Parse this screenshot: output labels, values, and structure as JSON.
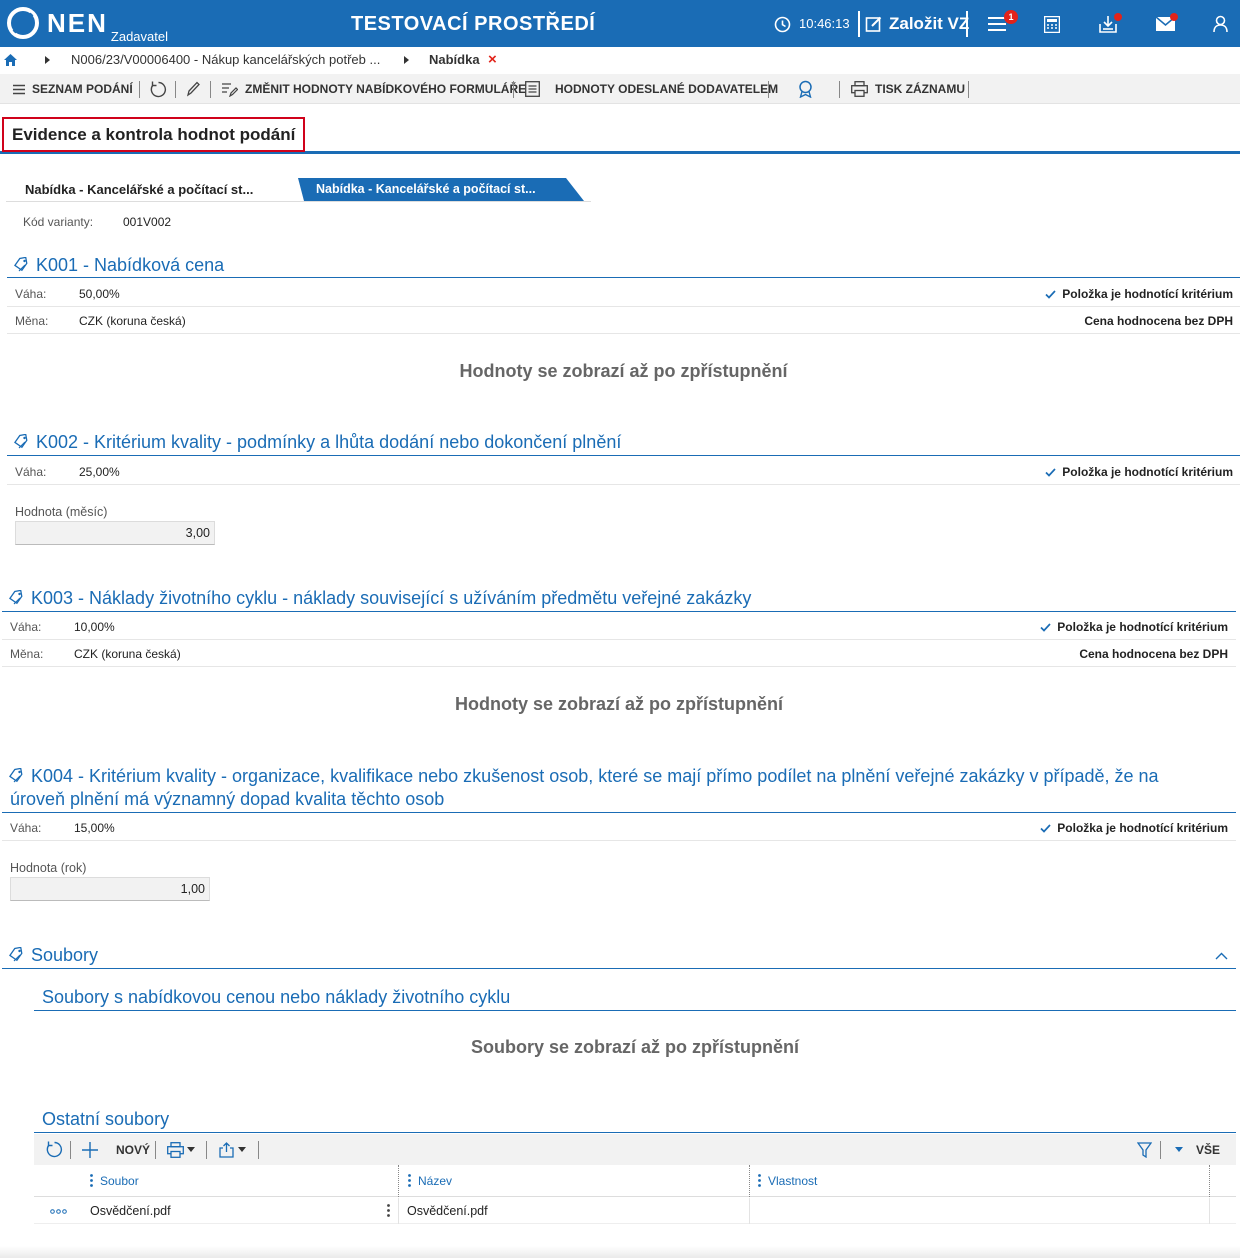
{
  "topbar": {
    "logo_text": "NEN",
    "logo_sub": "Zadavatel",
    "env_title": "TESTOVACÍ PROSTŘEDÍ",
    "time": "10:46:13",
    "create_label": "Založit VZ",
    "notification_count": "1",
    "brand_color": "#1a6cb5",
    "alert_color": "#e2231a"
  },
  "breadcrumb": {
    "item1": "N006/23/V00006400 - Nákup kancelářských potřeb ...",
    "item2": "Nabídka",
    "close": "×"
  },
  "toolbar": {
    "list": "SEZNAM PODÁNÍ",
    "change": "ZMĚNIT HODNOTY NABÍDKOVÉHO FORMULÁŘE",
    "sent": "HODNOTY ODESLANÉ DODAVATELEM",
    "print": "TISK ZÁZNAMU"
  },
  "page_title": "Evidence a kontrola hodnot podání",
  "tabs": {
    "active": "Nabídka - Kancelářské a počítací st...",
    "other": "Nabídka - Kancelářské a počítací st..."
  },
  "variant": {
    "label": "Kód varianty:",
    "value": "001V002"
  },
  "common": {
    "weight_label": "Váha:",
    "currency_label": "Měna:",
    "criterion_flag": "Položka je hodnotící kritérium",
    "price_note": "Cena hodnocena bez DPH",
    "hidden_values": "Hodnoty se zobrazí až po zpřístupnění"
  },
  "k001": {
    "title": "K001 - Nabídková cena",
    "weight": "50,00%",
    "currency": "CZK (koruna česká)"
  },
  "k002": {
    "title": "K002 - Kritérium kvality - podmínky a lhůta dodání nebo dokončení plnění",
    "weight": "25,00%",
    "field_label": "Hodnota (měsíc)",
    "field_value": "3,00"
  },
  "k003": {
    "title": "K003 - Náklady životního cyklu - náklady související s užíváním předmětu veřejné zakázky",
    "weight": "10,00%",
    "currency": "CZK (koruna česká)"
  },
  "k004": {
    "title_line1": "K004 - Kritérium kvality - organizace, kvalifikace nebo zkušenost osob, které se mají přímo podílet na plnění veřejné zakázky v případě, že na",
    "title_line2": "úroveň plnění má významný dopad kvalita těchto osob",
    "weight": "15,00%",
    "field_label": "Hodnota (rok)",
    "field_value": "1,00"
  },
  "files": {
    "title": "Soubory",
    "price_files_title": "Soubory s nabídkovou cenou nebo náklady životního cyklu",
    "hidden_files": "Soubory se zobrazí až po zpřístupnění",
    "other_title": "Ostatní soubory",
    "new_label": "NOVÝ",
    "all_label": "VŠE",
    "columns": [
      "Soubor",
      "Název",
      "Vlastnost"
    ],
    "rows": [
      {
        "soubor": "Osvědčení.pdf",
        "nazev": "Osvědčení.pdf",
        "vlastnost": ""
      }
    ]
  }
}
